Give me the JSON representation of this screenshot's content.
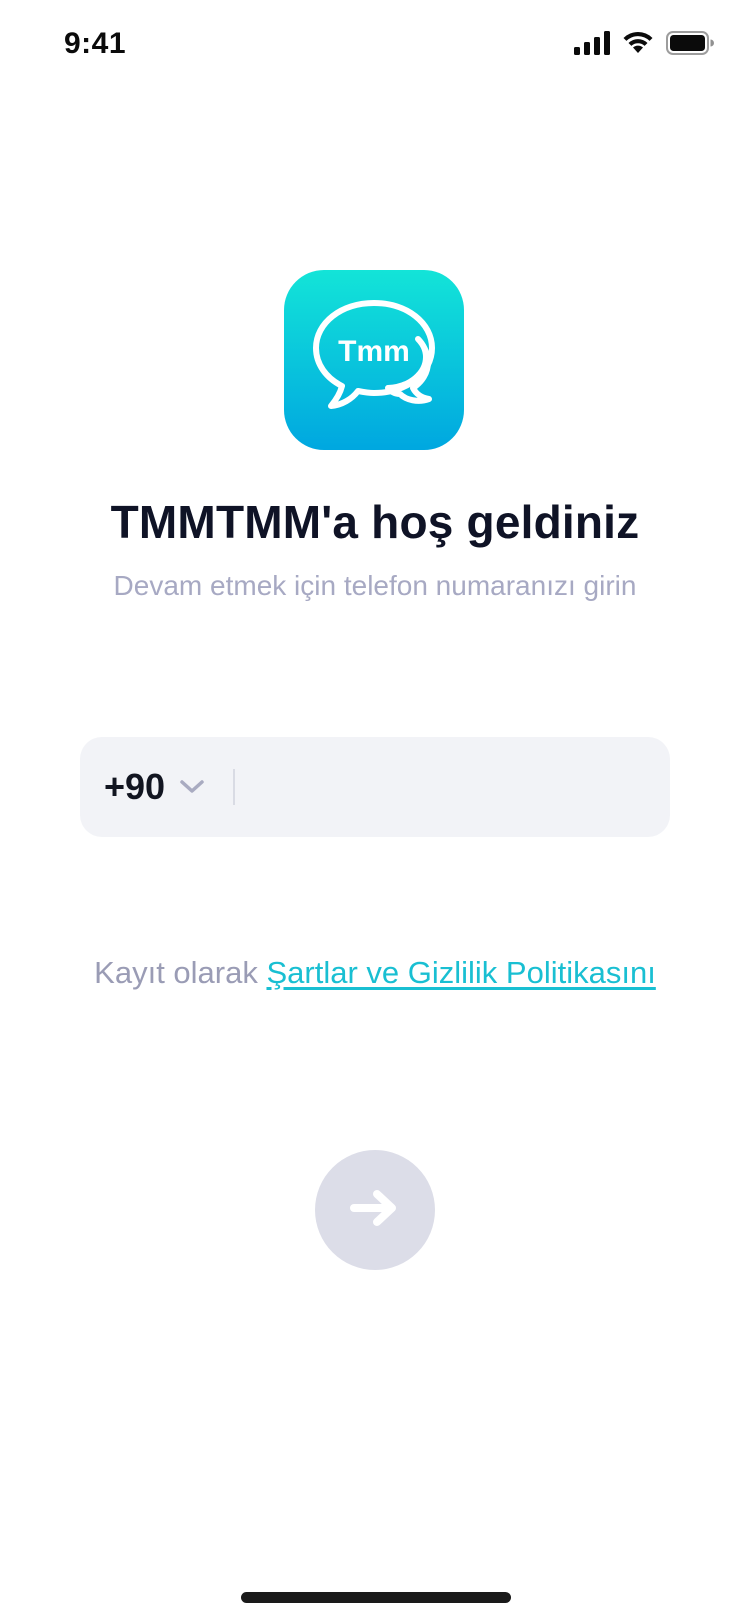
{
  "status_bar": {
    "time": "9:41",
    "icons": [
      "signal-icon",
      "wifi-icon",
      "battery-icon"
    ]
  },
  "app_icon": {
    "name": "app-logo",
    "text": "Tmm",
    "gradient": [
      "#13e4d8",
      "#00a7e0"
    ]
  },
  "title": "TMMTMM'a hoş geldiniz",
  "subtitle": "Devam etmek için telefon numaranızı girin",
  "phone": {
    "country_code": "+90",
    "value": "",
    "placeholder": ""
  },
  "terms": {
    "prefix": "Kayıt olarak ",
    "link": "Şartlar ve Gizlilik Politikasını"
  },
  "next_button": {
    "icon": "arrow-right-icon",
    "color": "#dcdde8"
  },
  "colors": {
    "accent": "#19bfd2",
    "title": "#0f1326",
    "muted": "#a7a9c3",
    "input_bg": "#f2f3f7"
  }
}
